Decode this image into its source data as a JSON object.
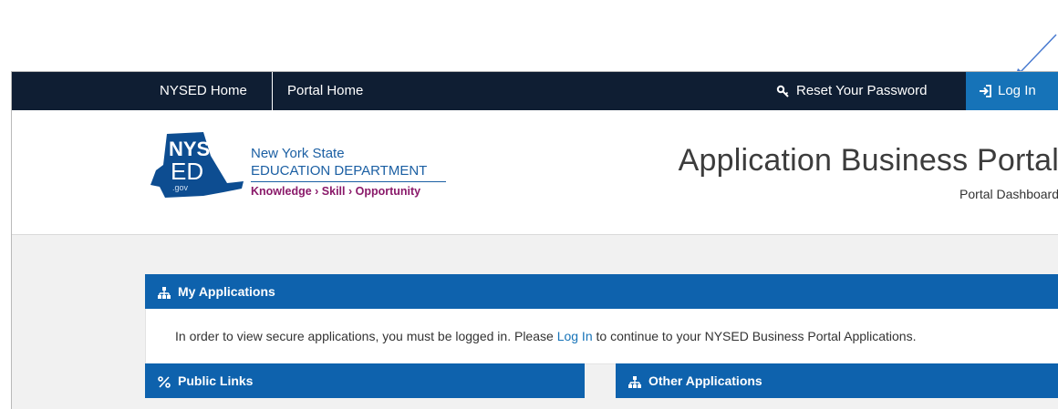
{
  "nav": {
    "home_label": "NYSED Home",
    "portal_label": "Portal Home",
    "reset_label": "Reset Your Password",
    "login_label": "Log In"
  },
  "header": {
    "logo_big": "NYS",
    "logo_ed": "ED",
    "logo_gov": ".gov",
    "org_line1": "New York State",
    "org_line2": "EDUCATION DEPARTMENT",
    "tagline": "Knowledge › Skill › Opportunity",
    "title": "Application Business Portal",
    "subtitle": "Portal Dashboard"
  },
  "my_apps": {
    "title": "My Applications",
    "msg_before": "In order to view secure applications, you must be logged in. Please ",
    "msg_link": "Log In",
    "msg_after": " to continue to your NYSED Business Portal Applications."
  },
  "public_links": {
    "title": "Public Links"
  },
  "other_apps": {
    "title": "Other Applications"
  },
  "colors": {
    "nav_bg": "#0f1e33",
    "accent": "#1673b8",
    "panel_header": "#0e62ad",
    "tagline": "#8a1a6a"
  }
}
